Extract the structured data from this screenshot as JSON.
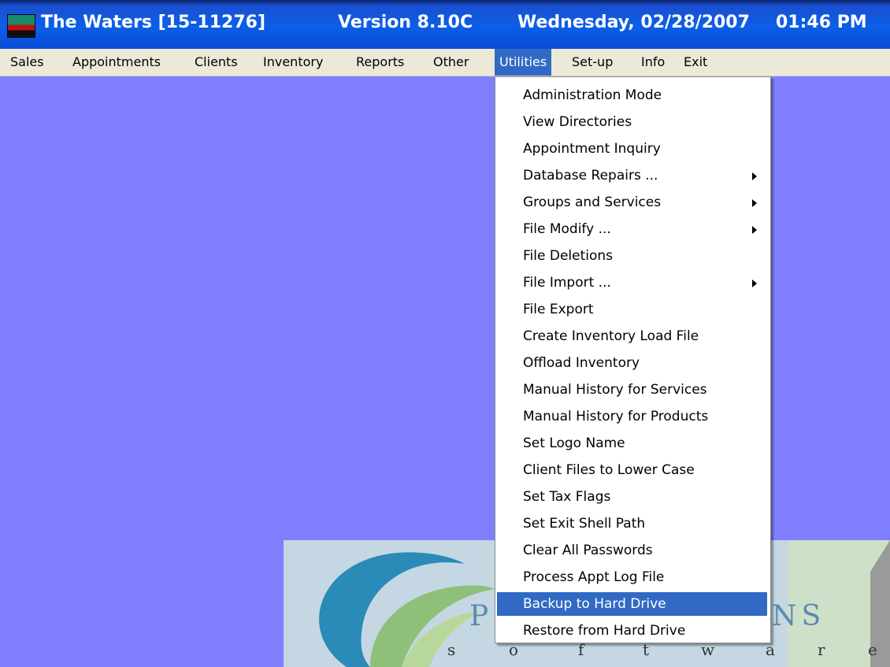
{
  "titlebar": {
    "app_name": "The Waters [15-11276]",
    "version": "Version 8.10C",
    "date": "Wednesday, 02/28/2007",
    "time": "01:46 PM"
  },
  "menubar": {
    "items": [
      {
        "label": "Sales"
      },
      {
        "label": "Appointments"
      },
      {
        "label": "Clients"
      },
      {
        "label": "Inventory"
      },
      {
        "label": "Reports"
      },
      {
        "label": "Other"
      },
      {
        "label": "Utilities",
        "active": true
      },
      {
        "label": "Set-up"
      },
      {
        "label": "Info"
      },
      {
        "label": "Exit"
      }
    ]
  },
  "utilities_menu": {
    "items": [
      {
        "label": "Administration Mode",
        "submenu": false
      },
      {
        "label": "View Directories",
        "submenu": false
      },
      {
        "label": "Appointment Inquiry",
        "submenu": false
      },
      {
        "label": "Database Repairs ...",
        "submenu": true
      },
      {
        "label": "Groups and Services",
        "submenu": true
      },
      {
        "label": "File Modify ...",
        "submenu": true
      },
      {
        "label": "File Deletions",
        "submenu": false
      },
      {
        "label": "File Import ...",
        "submenu": true
      },
      {
        "label": "File Export",
        "submenu": false
      },
      {
        "label": "Create Inventory Load File",
        "submenu": false
      },
      {
        "label": "Offload Inventory",
        "submenu": false
      },
      {
        "label": "Manual History for Services",
        "submenu": false
      },
      {
        "label": "Manual History for Products",
        "submenu": false
      },
      {
        "label": "Set Logo Name",
        "submenu": false
      },
      {
        "label": "Client Files to Lower Case",
        "submenu": false
      },
      {
        "label": "Set Tax Flags",
        "submenu": false
      },
      {
        "label": "Set Exit Shell Path",
        "submenu": false
      },
      {
        "label": "Clear All Passwords",
        "submenu": false
      },
      {
        "label": "Process Appt Log File",
        "submenu": false
      },
      {
        "label": "Backup to Hard Drive",
        "submenu": false,
        "highlighted": true
      },
      {
        "label": "Restore from Hard Drive",
        "submenu": false
      }
    ]
  },
  "splash": {
    "big_letters_left": "P",
    "big_letters_right": "NS",
    "small_letters": [
      "s",
      "o",
      "f",
      "t",
      "w",
      "a",
      "r",
      "e"
    ]
  },
  "colors": {
    "desktop": "#8080ff",
    "menu_highlight": "#316ac5",
    "titlebar": "#0b5fe8"
  }
}
